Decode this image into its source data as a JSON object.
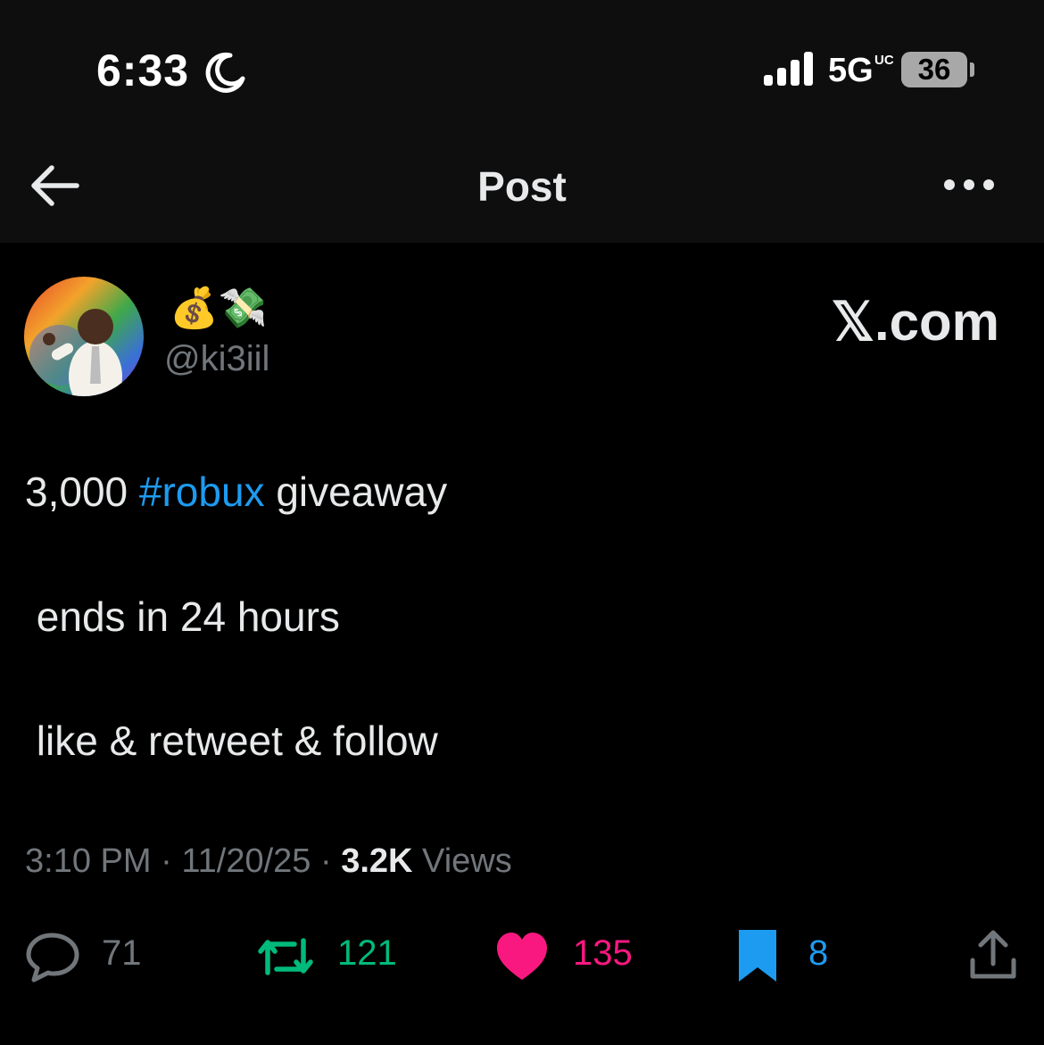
{
  "status_bar": {
    "time": "6:33",
    "network": "5G",
    "network_suffix": "UC",
    "battery": "36"
  },
  "nav": {
    "title": "Post"
  },
  "author": {
    "display_name": "💰💸",
    "handle": "@ki3iil",
    "avatar_icon": "profile-photo"
  },
  "watermark": "𝕏.com",
  "tweet": {
    "line1_prefix": "3,000 ",
    "line1_hashtag": "#robux",
    "line1_suffix": " giveaway",
    "line2": " ends in 24 hours",
    "line3": " like & retweet & follow"
  },
  "meta": {
    "time": "3:10 PM",
    "separator": " · ",
    "date": "11/20/25",
    "views_count": "3.2K",
    "views_label": " Views"
  },
  "actions": {
    "replies": "71",
    "reposts": "121",
    "likes": "135",
    "bookmarks": "8"
  },
  "colors": {
    "background": "#000000",
    "text": "#e7e9ea",
    "muted": "#71767b",
    "link": "#1d9bf0",
    "repost_active": "#00ba7c",
    "like_active": "#f91880",
    "bookmark_active": "#1d9bf0"
  }
}
